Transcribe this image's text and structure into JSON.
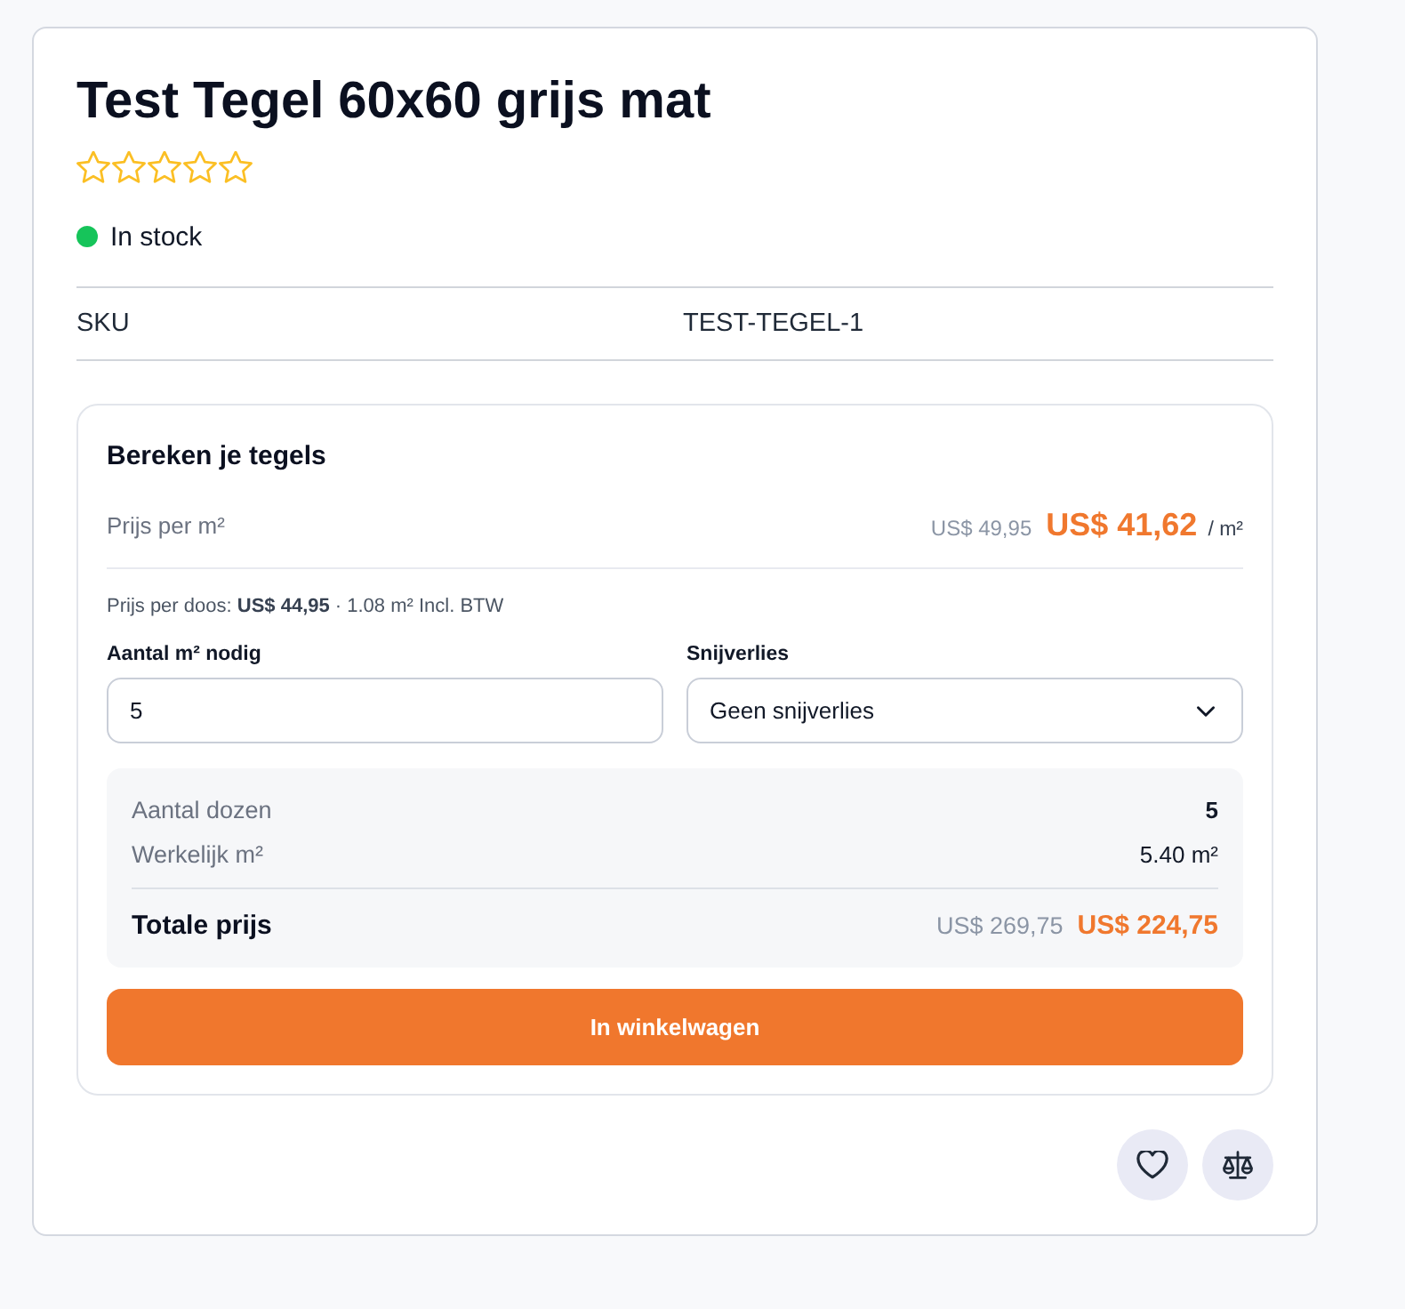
{
  "product": {
    "title": "Test Tegel 60x60 grijs mat",
    "rating": {
      "stars": 0
    },
    "stock": {
      "label": "In stock",
      "in_stock": true
    }
  },
  "specs": [
    {
      "label": "SKU",
      "value": "TEST-TEGEL-1"
    }
  ],
  "calculator": {
    "title": "Bereken je tegels",
    "price_per_m2": {
      "label": "Prijs per m²",
      "old_price": "US$ 49,95",
      "price": "US$ 41,62",
      "unit": "/ m²"
    },
    "box_note": "Prijs per doos: **US$ 44,95** · 1.08 m² Incl. BTW",
    "fields": [
      {
        "kind": "input",
        "label": "Aantal m² nodig",
        "value": "5"
      },
      {
        "kind": "select",
        "label": "Snijverlies",
        "value": "Geen snijverlies"
      }
    ],
    "summary": {
      "rows": [
        {
          "label": "Aantal dozen",
          "value": "5",
          "bold": true
        },
        {
          "label": "Werkelijk m²",
          "value": "5.40 m²",
          "bold": false
        }
      ],
      "total": {
        "label": "Totale prijs",
        "old_price": "US$ 269,75",
        "price": "US$ 224,75"
      }
    },
    "add_to_cart": "In winkelwagen"
  }
}
